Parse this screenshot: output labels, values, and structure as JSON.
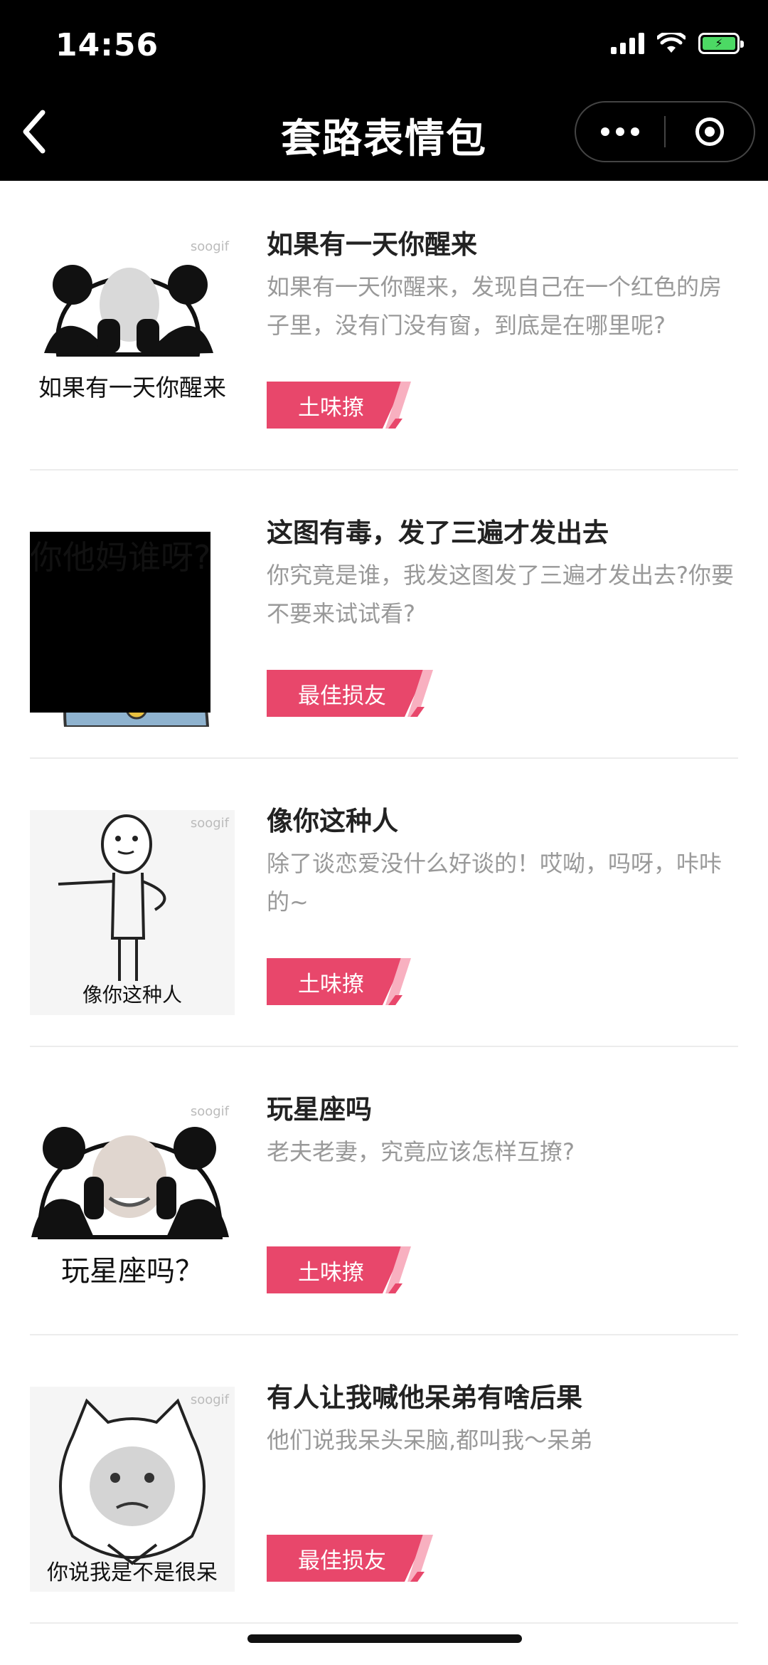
{
  "status_bar": {
    "time": "14:56"
  },
  "nav": {
    "title": "套路表情包"
  },
  "items": [
    {
      "caption": "如果有一天你醒来",
      "watermark": "soogif",
      "title": "如果有一天你醒来",
      "desc": "如果有一天你醒来，发现自己在一个红色的房子里，没有门没有窗，到底是在哪里呢?",
      "tag": "土味撩"
    },
    {
      "caption": "你他妈谁呀?",
      "watermark": "",
      "title": "这图有毒，发了三遍才发出去",
      "desc": "你究竟是谁，我发这图发了三遍才发出去?你要不要来试试看?",
      "tag": "最佳损友"
    },
    {
      "caption": "像你这种人",
      "watermark": "soogif",
      "title": "像你这种人",
      "desc": "除了谈恋爱没什么好谈的！哎呦，吗呀，咔咔的~",
      "tag": "土味撩"
    },
    {
      "caption": "玩星座吗？",
      "watermark": "soogif",
      "title": "玩星座吗",
      "desc": "老夫老妻，究竟应该怎样互撩?",
      "tag": "土味撩"
    },
    {
      "caption": "你说我是不是很呆",
      "watermark": "soogif",
      "title": "有人让我喊他呆弟有啥后果",
      "desc": "他们说我呆头呆脑,都叫我～呆弟",
      "tag": "最佳损友"
    }
  ]
}
